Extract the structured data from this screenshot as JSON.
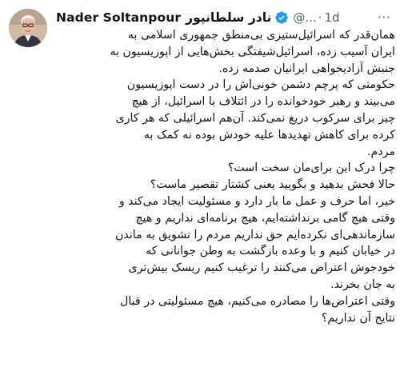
{
  "author": {
    "name_latin": "Nader Soltanpour",
    "name_farsi": "نادر سلطانپور",
    "handle": "@...",
    "separator": "·",
    "timestamp": "1d",
    "verified": true
  },
  "menu": {
    "more_icon": "more-horizontal-icon",
    "more_label": "···"
  },
  "colors": {
    "text": "#0f1419",
    "secondary": "#536471",
    "verified_blue": "#1d9bf0"
  },
  "tweet_lines": [
    "همان‌قدر که اسرائیل‌ستیزی بی‌منطق جمهوری اسلامی به",
    "ایران آسیب زده، اسرائیل‌شیفتگی بخش‌هایی از اپوزیسیون به",
    "جنبش آزادیخواهی ایرانیان صدمه زده.",
    "حکومتی که پرچم دشمن خونی‌اش را در دست اپوزیسیون",
    "می‌بیند و رهبر خودخوانده را در ائتلاف با اسرائیل، از هیچ",
    "چیز برای سرکوب دریغ نمی‌کند. آن‌هم اسرائیلی که هر کاری",
    "کرده برای کاهش تهدیدها علیه خودش بوده نه کمک به",
    "مردم.",
    "چرا درک این برای‌مان سخت است؟",
    "حالا فحش بدهید و  بگویید یعنی کشتار تقصیر ماست؟",
    "خیر، اما حرف و عمل ما بار دارد و مسئولیت ایجاد می‌کند و",
    "وقتی هیچ گامی برنداشته‌ایم، هیچ برنامه‌ای نداریم و هیچ",
    "سازماندهی‌ای نکرده‌ایم حق نداریم مردم را تشویق به ماندن",
    "در خیابان کنیم و با وعده بازگشت به وطن جوانانی که",
    "خودجوش اعتراض می‌کنند را ترغیب کنیم ریسک بیش‌تری",
    "به جان بخرند.",
    "وقتی اعتراض‌ها را مصادره می‌کنیم، هیچ مسئولیتی در قبال",
    "نتایج آن نداریم؟"
  ]
}
